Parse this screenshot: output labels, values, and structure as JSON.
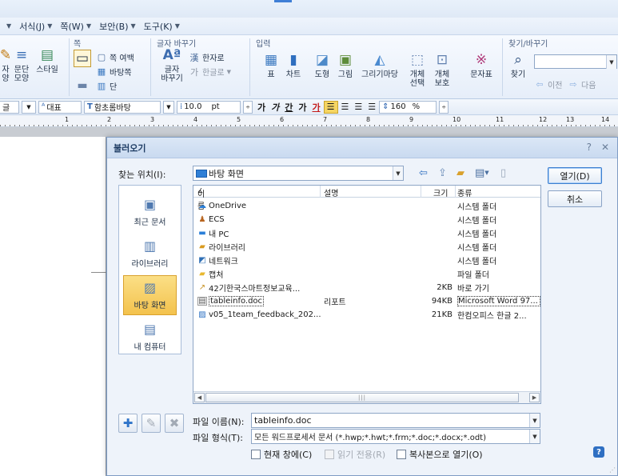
{
  "menubar": {
    "items": [
      {
        "label": "서식(J)"
      },
      {
        "label": "쪽(W)"
      },
      {
        "label": "보안(B)"
      },
      {
        "label": "도구(K)"
      }
    ]
  },
  "ribbon": {
    "groups": {
      "page": "쪽",
      "char_change": "글자 바꾸기",
      "input": "입력",
      "find": "찾기/바꾸기"
    },
    "para_shape": "문단\n모양",
    "style": "스타일",
    "char_shape_partial": "자\n양",
    "page_border": "쪽 여백",
    "background": "바탕쪽",
    "columns": "단",
    "to_hanja": "한자로",
    "to_hangul": "한글로",
    "char_change_btn": "글자\n바꾸기",
    "table": "표",
    "chart": "차트",
    "shape": "도형",
    "picture": "그림",
    "drawing": "그리기마당",
    "object_select": "개체\n선택",
    "object_protect": "개체\n보호",
    "symbols": "문자표",
    "find_btn": "찾기",
    "prev": "이전",
    "next": "다음"
  },
  "format_toolbar": {
    "style_partial": "글",
    "representative": "대표",
    "font": "함초롬바탕",
    "size": "10.0",
    "size_unit": "pt",
    "zoom": "160",
    "zoom_unit": "%"
  },
  "ruler": {
    "numbers": [
      "1",
      "2",
      "3",
      "4",
      "5",
      "6",
      "7",
      "8",
      "9",
      "10",
      "11",
      "12",
      "13",
      "14"
    ]
  },
  "dialog": {
    "title": "불러오기",
    "look_in_label": "찾는 위치(I):",
    "look_in_value": "바탕 화면",
    "open_button": "열기(D)",
    "cancel_button": "취소",
    "places": [
      {
        "label": "최근 문서"
      },
      {
        "label": "라이브러리"
      },
      {
        "label": "바탕 화면"
      },
      {
        "label": "내 컴퓨터"
      }
    ],
    "columns": {
      "name": "이름",
      "desc": "설명",
      "size": "크기",
      "type": "종류"
    },
    "files": [
      {
        "name": "OneDrive",
        "desc": "",
        "size": "",
        "type": "시스템 폴더"
      },
      {
        "name": "ECS",
        "desc": "",
        "size": "",
        "type": "시스템 폴더"
      },
      {
        "name": "내 PC",
        "desc": "",
        "size": "",
        "type": "시스템 폴더"
      },
      {
        "name": "라이브러리",
        "desc": "",
        "size": "",
        "type": "시스템 폴더"
      },
      {
        "name": "네트워크",
        "desc": "",
        "size": "",
        "type": "시스템 폴더"
      },
      {
        "name": "캡처",
        "desc": "",
        "size": "",
        "type": "파일 폴더"
      },
      {
        "name": "42기한국스마트정보교육...",
        "desc": "",
        "size": "2KB",
        "type": "바로 가기"
      },
      {
        "name": "tableinfo.doc",
        "desc": "리포트",
        "size": "94KB",
        "type": "Microsoft Word 97..."
      },
      {
        "name": "v05_1team_feedback_202...",
        "desc": "",
        "size": "21KB",
        "type": "한컴오피스 한글 2..."
      }
    ],
    "file_name_label": "파일 이름(N):",
    "file_name_value": "tableinfo.doc",
    "file_type_label": "파일 형식(T):",
    "file_type_value": "모든 워드프로세서 문서 (*.hwp;*.hwt;*.frm;*.doc;*.docx;*.odt)",
    "check_current_window": "현재 창에(C)",
    "check_read_only": "읽기 전용(R)",
    "check_open_copy": "복사본으로 열기(O)"
  }
}
